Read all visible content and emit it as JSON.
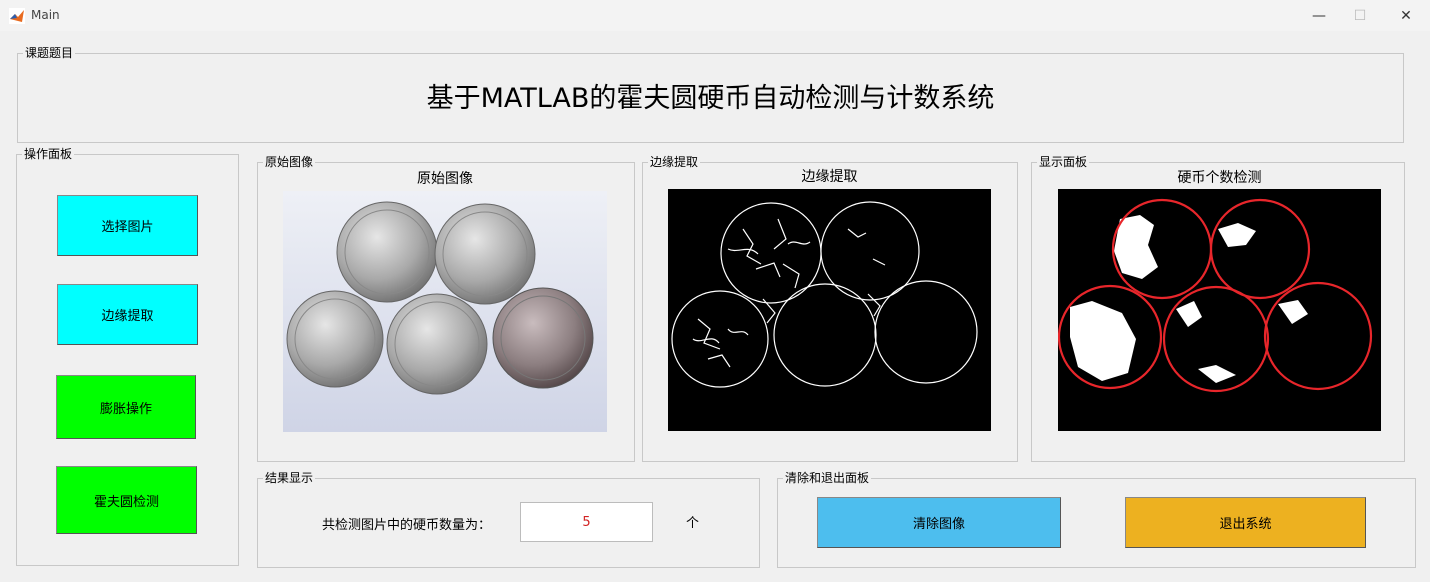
{
  "window": {
    "title": "Main",
    "minimize_icon": "minimize-icon",
    "maximize_icon": "maximize-icon",
    "close_icon": "close-icon"
  },
  "topic_panel": {
    "title": "课题题目",
    "project_title": "基于MATLAB的霍夫圆硬币自动检测与计数系统"
  },
  "operation_panel": {
    "title": "操作面板",
    "buttons": [
      {
        "label": "选择图片",
        "color": "#00ffff"
      },
      {
        "label": "边缘提取",
        "color": "#00ffff"
      },
      {
        "label": "膨胀操作",
        "color": "#00ff00"
      },
      {
        "label": "霍夫圆检测",
        "color": "#00ff00"
      }
    ]
  },
  "original_panel": {
    "title": "原始图像",
    "axes_title": "原始图像"
  },
  "edge_panel": {
    "title": "边缘提取",
    "axes_title": "边缘提取"
  },
  "display_panel": {
    "title": "显示面板",
    "axes_title": "硬币个数检测",
    "circle_color": "#e8262b"
  },
  "result_panel": {
    "title": "结果显示",
    "label": "共检测图片中的硬币数量为：",
    "value": "5",
    "unit": "个",
    "value_color": "#d22222"
  },
  "exit_panel": {
    "title": "清除和退出面板",
    "clear_label": "清除图像",
    "exit_label": "退出系统",
    "clear_color": "#4dbeee",
    "exit_color": "#edb120"
  }
}
